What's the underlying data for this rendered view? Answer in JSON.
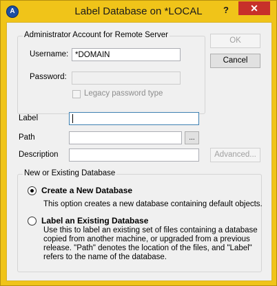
{
  "window": {
    "title": "Label Database on *LOCAL",
    "help_label": "?",
    "close_label": "✕"
  },
  "admin_group": {
    "legend": "Administrator Account for Remote Server",
    "username_label": "Username:",
    "username_value": "*DOMAIN",
    "password_label": "Password:",
    "password_value": "",
    "legacy_label": "Legacy password type"
  },
  "buttons": {
    "ok": "OK",
    "cancel": "Cancel",
    "browse": "...",
    "advanced": "Advanced..."
  },
  "fields": {
    "label_label": "Label",
    "label_value": "",
    "path_label": "Path",
    "path_value": "",
    "description_label": "Description",
    "description_value": ""
  },
  "db_group": {
    "legend": "New or Existing Database",
    "create_title": "Create a New Database",
    "create_desc": "This option creates a new database containing default objects.",
    "label_title": "Label an Existing Database",
    "label_desc_lines": [
      "Use this to label an existing set of files containing a database",
      "copied from another machine, or upgraded from a previous",
      "release.  \"Path\" denotes the location of the files, and \"Label\"",
      "refers to the name of the database."
    ],
    "selected": "create"
  }
}
